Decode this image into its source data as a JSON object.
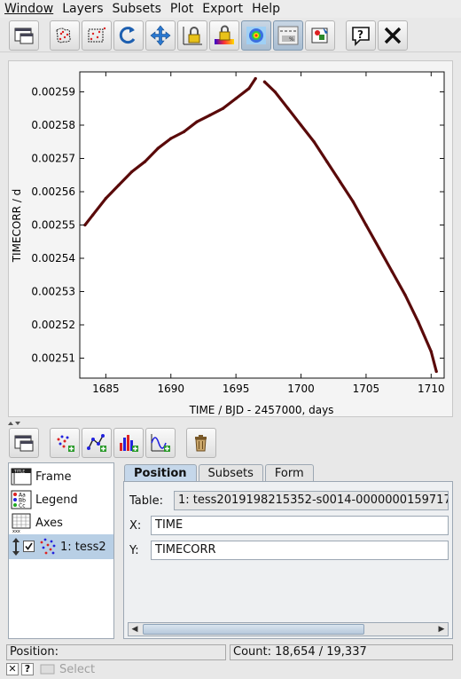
{
  "menu": [
    "Window",
    "Layers",
    "Subsets",
    "Plot",
    "Export",
    "Help"
  ],
  "toolbar": {
    "icons": [
      "window-icon",
      "subset-draw-icon",
      "subset-shape-icon",
      "replot-icon",
      "navigate-icon",
      "axis-lock-icon",
      "aux-lock-icon",
      "density-icon",
      "sketch-icon",
      "legend-icon",
      "help-icon",
      "close-icon"
    ]
  },
  "chart_data": {
    "type": "line",
    "xlabel": "TIME / BJD - 2457000, days",
    "ylabel": "TIMECORR / d",
    "xlim": [
      1683.0,
      1711.0
    ],
    "ylim": [
      0.002504,
      0.002596
    ],
    "x_ticks": [
      "1685",
      "1690",
      "1695",
      "1700",
      "1705",
      "1710"
    ],
    "y_ticks": [
      "0.00251",
      "0.00252",
      "0.00253",
      "0.00254",
      "0.00255",
      "0.00256",
      "0.00257",
      "0.00258",
      "0.00259"
    ],
    "color": "#5a0a0a",
    "series": [
      {
        "x": [
          1683.4,
          1684.0,
          1685.0,
          1686.0,
          1687.0,
          1688.0,
          1689.0,
          1690.0,
          1691.0,
          1692.0,
          1693.0,
          1694.0,
          1695.0,
          1696.0,
          1696.5
        ],
        "values": [
          0.00255,
          0.002553,
          0.002558,
          0.002562,
          0.002566,
          0.002569,
          0.002573,
          0.002576,
          0.002578,
          0.002581,
          0.002583,
          0.002585,
          0.002588,
          0.002591,
          0.002594
        ]
      },
      {
        "x": [
          1697.2,
          1698.0,
          1699.0,
          1700.0,
          1701.0,
          1702.0,
          1703.0,
          1704.0,
          1705.0,
          1706.0,
          1707.0,
          1708.0,
          1709.0,
          1710.0,
          1710.4
        ],
        "values": [
          0.002593,
          0.00259,
          0.002585,
          0.00258,
          0.002575,
          0.002569,
          0.002563,
          0.002557,
          0.00255,
          0.002543,
          0.002536,
          0.002529,
          0.002521,
          0.002512,
          0.002506
        ]
      }
    ]
  },
  "toolbar2": {
    "icons": [
      "window-icon",
      "add-scatter-layer-icon",
      "add-line-layer-icon",
      "add-histogram-layer-icon",
      "add-function-layer-icon",
      "delete-icon"
    ]
  },
  "layers": {
    "frame": "Frame",
    "legend": "Legend",
    "axes": "Axes",
    "table_layer": "1: tess2"
  },
  "tabs": [
    "Position",
    "Subsets",
    "Form"
  ],
  "position": {
    "table_label": "Table:",
    "table_value": "1: tess2019198215352-s0014-0000000159717",
    "x_label": "X:",
    "x_value": "TIME",
    "y_label": "Y:",
    "y_value": "TIMECORR"
  },
  "status": {
    "position_label": "Position:",
    "count_text": "Count: 18,654 / 19,337"
  },
  "bottom": {
    "select_label": "Select"
  }
}
